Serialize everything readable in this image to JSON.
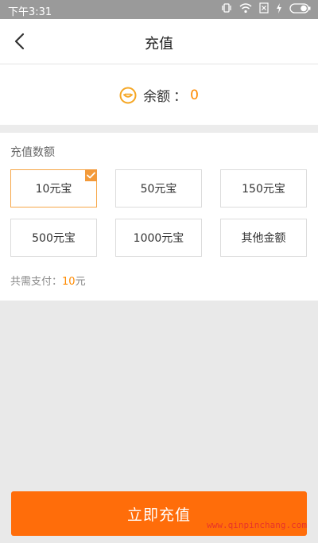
{
  "status_bar": {
    "time": "下午3:31"
  },
  "header": {
    "title": "充值"
  },
  "balance": {
    "label": "余额",
    "separator": "：",
    "value": "0"
  },
  "recharge": {
    "section_label": "充值数额",
    "options": [
      {
        "label": "10元宝",
        "selected": true
      },
      {
        "label": "50元宝",
        "selected": false
      },
      {
        "label": "150元宝",
        "selected": false
      },
      {
        "label": "500元宝",
        "selected": false
      },
      {
        "label": "1000元宝",
        "selected": false
      },
      {
        "label": "其他金额",
        "selected": false
      }
    ],
    "total_label": "共需支付：",
    "total_amount": "10",
    "total_unit": "元"
  },
  "footer": {
    "submit_label": "立即充值"
  },
  "watermark": "www.qinpinchang.com",
  "colors": {
    "accent": "#ff8a00",
    "button": "#ff6d0a",
    "selected_border": "#f7a84a"
  },
  "icons": [
    "back-arrow-icon",
    "coin-icon",
    "checkmark-icon",
    "vibrate-icon",
    "wifi-icon",
    "sim-icon",
    "charging-icon",
    "battery-icon"
  ]
}
